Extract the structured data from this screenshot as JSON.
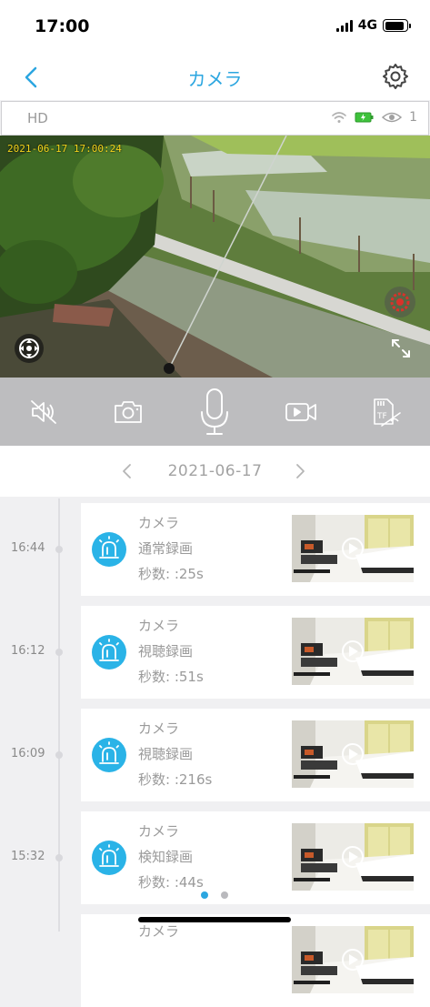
{
  "status_bar": {
    "time": "17:00",
    "network": "4G"
  },
  "nav": {
    "title": "カメラ"
  },
  "info_bar": {
    "quality": "HD",
    "viewer_count": "1"
  },
  "video": {
    "timestamp": "2021-06-17 17:00:24"
  },
  "controls": [
    "mute-icon",
    "snapshot-icon",
    "microphone-icon",
    "record-video-icon",
    "sd-card-icon"
  ],
  "date_bar": {
    "date": "2021-06-17"
  },
  "records": [
    {
      "time": "16:44",
      "name": "カメラ",
      "type": "通常録画",
      "duration": "秒数: :25s"
    },
    {
      "time": "16:12",
      "name": "カメラ",
      "type": "視聴録画",
      "duration": "秒数: :51s"
    },
    {
      "time": "16:09",
      "name": "カメラ",
      "type": "視聴録画",
      "duration": "秒数: :216s"
    },
    {
      "time": "15:32",
      "name": "カメラ",
      "type": "検知録画",
      "duration": "秒数: :44s"
    },
    {
      "time": "",
      "name": "カメラ",
      "type": "",
      "duration": ""
    }
  ],
  "pagination": {
    "total": 2,
    "active": 0
  },
  "colors": {
    "accent": "#2ba6e0",
    "icon_bg": "#2ab3e7",
    "battery_green": "#3ec23b",
    "timestamp": "#f3d21b",
    "alarm_red": "#d8322b"
  }
}
